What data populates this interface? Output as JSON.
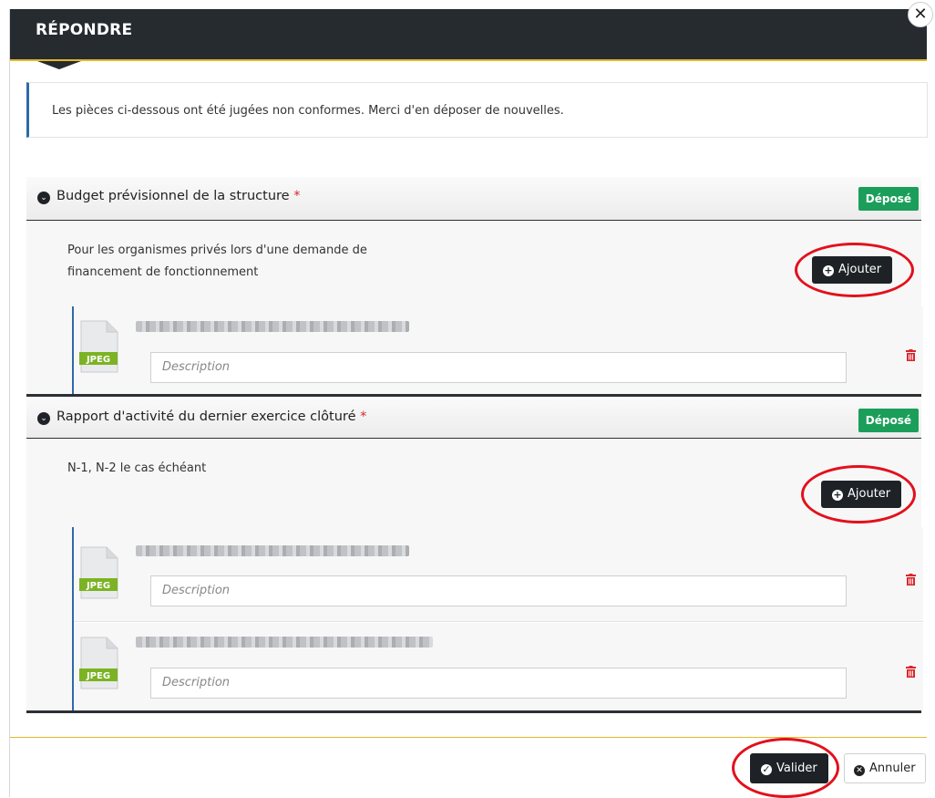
{
  "dialog": {
    "title": "RÉPONDRE",
    "close_icon": "close-icon"
  },
  "notice": "Les pièces ci-dessous ont été jugées non conformes. Merci d'en déposer de nouvelles.",
  "sections": [
    {
      "title": "Budget prévisionnel de la structure",
      "required_mark": "*",
      "status": "Déposé",
      "description_line1": "Pour les organismes privés lors d'une demande de",
      "description_line2": "financement de fonctionnement",
      "add_label": "Ajouter",
      "files": [
        {
          "type": "JPEG",
          "description_placeholder": "Description"
        }
      ]
    },
    {
      "title": "Rapport d'activité du dernier exercice clôturé",
      "required_mark": "*",
      "status": "Déposé",
      "description_line1": "N-1, N-2 le cas échéant",
      "add_label": "Ajouter",
      "files": [
        {
          "type": "JPEG",
          "description_placeholder": "Description"
        },
        {
          "type": "JPEG",
          "description_placeholder": "Description"
        }
      ]
    }
  ],
  "footer": {
    "validate_label": "Valider",
    "cancel_label": "Annuler"
  },
  "colors": {
    "header": "#262b30",
    "accent_yellow": "#e4b928",
    "badge_green": "#1b9e5a",
    "highlight_red": "#e3101b",
    "trash_red": "#d9262b"
  }
}
